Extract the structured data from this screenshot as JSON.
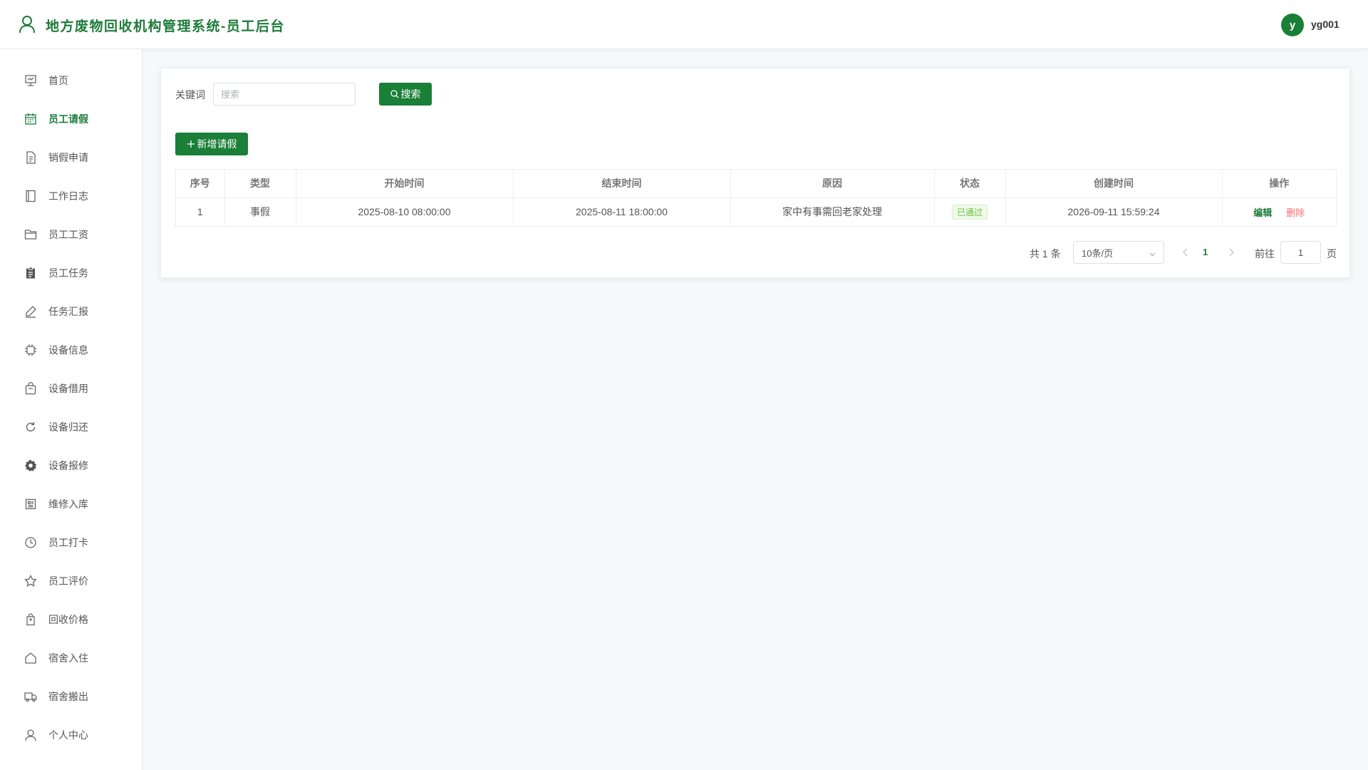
{
  "header": {
    "app_title": "地方废物回收机构管理系统-员工后台",
    "avatar_letter": "y",
    "username": "yg001"
  },
  "sidebar": {
    "items": [
      {
        "label": "首页",
        "icon": "presentation-icon",
        "active": false
      },
      {
        "label": "员工请假",
        "icon": "calendar-icon",
        "active": true
      },
      {
        "label": "销假申请",
        "icon": "document-icon",
        "active": false
      },
      {
        "label": "工作日志",
        "icon": "notebook-icon",
        "active": false
      },
      {
        "label": "员工工资",
        "icon": "folder-icon",
        "active": false
      },
      {
        "label": "员工任务",
        "icon": "clipboard-icon",
        "active": false
      },
      {
        "label": "任务汇报",
        "icon": "edit-pen-icon",
        "active": false
      },
      {
        "label": "设备信息",
        "icon": "cpu-icon",
        "active": false
      },
      {
        "label": "设备借用",
        "icon": "bag-icon",
        "active": false
      },
      {
        "label": "设备归还",
        "icon": "refresh-icon",
        "active": false
      },
      {
        "label": "设备报修",
        "icon": "gear-icon",
        "active": false
      },
      {
        "label": "维修入库",
        "icon": "box-icon",
        "active": false
      },
      {
        "label": "员工打卡",
        "icon": "clock-icon",
        "active": false
      },
      {
        "label": "员工评价",
        "icon": "star-icon",
        "active": false
      },
      {
        "label": "回收价格",
        "icon": "price-tag-icon",
        "active": false
      },
      {
        "label": "宿舍入住",
        "icon": "house-icon",
        "active": false
      },
      {
        "label": "宿舍搬出",
        "icon": "truck-icon",
        "active": false
      },
      {
        "label": "个人中心",
        "icon": "user-icon",
        "active": false
      }
    ]
  },
  "search": {
    "label": "关键词",
    "placeholder": "搜索",
    "value": "",
    "button_label": "搜索"
  },
  "toolbar": {
    "add_label": "新增请假"
  },
  "table": {
    "columns": [
      "序号",
      "类型",
      "开始时间",
      "结束时间",
      "原因",
      "状态",
      "创建时间",
      "操作"
    ],
    "rows": [
      {
        "index": "1",
        "type": "事假",
        "start_time": "2025-08-10 08:00:00",
        "end_time": "2025-08-11 18:00:00",
        "reason": "家中有事需回老家处理",
        "status": "已通过",
        "created_time": "2026-09-11 15:59:24",
        "edit_label": "编辑",
        "delete_label": "删除"
      }
    ]
  },
  "pagination": {
    "total_text": "共 1 条",
    "page_size": "10条/页",
    "current_page": "1",
    "goto_label": "前往",
    "goto_value": "1",
    "page_suffix": "页"
  },
  "colors": {
    "brand": "#1a7f37",
    "brand_text": "#1e7b3a",
    "danger": "#f56c6c",
    "success": "#67c23a",
    "background": "#f7f8fa"
  }
}
